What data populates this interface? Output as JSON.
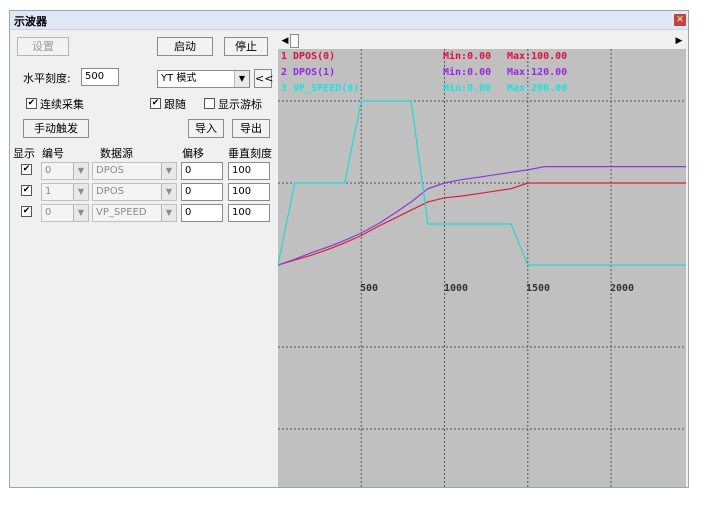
{
  "window": {
    "title": "示波器"
  },
  "controls": {
    "settings_button": "设置",
    "start_button": "启动",
    "stop_button": "停止",
    "h_scale_label": "水平刻度:",
    "h_scale_value": "500",
    "mode_value": "YT 模式",
    "collapse_button": "<<",
    "continuous_label": "连续采集",
    "follow_label": "跟随",
    "cursor_label": "显示游标",
    "manual_trigger_button": "手动触发",
    "import_button": "导入",
    "export_button": "导出"
  },
  "table": {
    "headers": {
      "show": "显示",
      "index": "编号",
      "source": "数据源",
      "offset": "偏移",
      "scale": "垂直刻度"
    },
    "rows": [
      {
        "show": true,
        "index": "0",
        "source": "DPOS",
        "offset": "0",
        "scale": "100"
      },
      {
        "show": true,
        "index": "1",
        "source": "DPOS",
        "offset": "0",
        "scale": "100"
      },
      {
        "show": true,
        "index": "0",
        "source": "VP_SPEED",
        "offset": "0",
        "scale": "100"
      }
    ]
  },
  "legend": [
    {
      "name": "1 DPOS(0)",
      "min": "Min:0.00",
      "max": "Max:100.00",
      "color": "#e0103a"
    },
    {
      "name": "2 DPOS(1)",
      "min": "Min:0.00",
      "max": "Max:120.00",
      "color": "#9a28e0"
    },
    {
      "name": "3 VP_SPEED(0)",
      "min": "Min:0.00",
      "max": "Max:200.00",
      "color": "#20e0e0"
    }
  ],
  "icons": {
    "close": "close-icon",
    "scroll_left": "scroll-left-icon",
    "scroll_right": "scroll-right-icon",
    "dropdown": "dropdown-arrow-icon",
    "check": "check-icon"
  },
  "chart_data": {
    "type": "line",
    "x_ticks": [
      "500",
      "1000",
      "1500",
      "2000"
    ],
    "xlim": [
      0,
      2450
    ],
    "grid": true,
    "series": [
      {
        "name": "1 DPOS(0)",
        "color": "#d6203c",
        "x": [
          0,
          100,
          200,
          300,
          400,
          500,
          600,
          700,
          800,
          900,
          1000,
          1100,
          1200,
          1300,
          1400,
          1500,
          2450
        ],
        "y": [
          0,
          6,
          12,
          19,
          27,
          36,
          47,
          57,
          67,
          77,
          82,
          84,
          87,
          90,
          93,
          100,
          100
        ]
      },
      {
        "name": "2 DPOS(1)",
        "color": "#8a3ad8",
        "x": [
          0,
          100,
          200,
          300,
          400,
          500,
          600,
          700,
          800,
          900,
          1000,
          1100,
          1200,
          1300,
          1400,
          1500,
          1600,
          2450
        ],
        "y": [
          0,
          7,
          15,
          22,
          30,
          39,
          50,
          63,
          77,
          93,
          100,
          104,
          107,
          110,
          113,
          116,
          120,
          120
        ]
      },
      {
        "name": "3 VP_SPEED(0)",
        "color": "#20d8d8",
        "x": [
          0,
          100,
          200,
          300,
          400,
          500,
          600,
          700,
          800,
          900,
          1000,
          1100,
          1200,
          1300,
          1400,
          1500,
          2450
        ],
        "y": [
          0,
          100,
          100,
          100,
          100,
          200,
          200,
          200,
          200,
          50,
          50,
          50,
          50,
          50,
          50,
          0,
          0
        ]
      }
    ]
  }
}
